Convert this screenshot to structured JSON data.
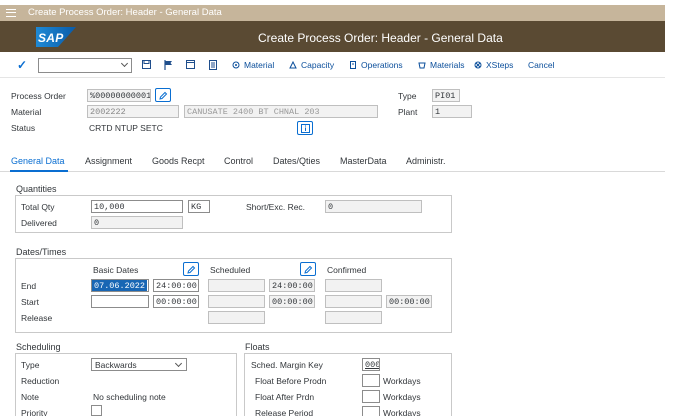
{
  "window": {
    "title": "Create Process Order: Header - General Data"
  },
  "shell": {
    "logo": "SAP",
    "title": "Create Process Order: Header - General Data"
  },
  "toolbar": {
    "confirm_icon": "check-icon",
    "command_value": "",
    "buttons": [
      {
        "label": "Material",
        "icon": "material-icon"
      },
      {
        "label": "Capacity",
        "icon": "capacity-icon"
      },
      {
        "label": "Operations",
        "icon": "operations-icon"
      },
      {
        "label": "Materials",
        "icon": "materials-icon"
      },
      {
        "label": "XSteps",
        "icon": "xsteps-icon"
      },
      {
        "label": "Cancel",
        "icon": ""
      }
    ]
  },
  "header": {
    "process_order": {
      "label": "Process Order",
      "value": "%00000000001"
    },
    "material": {
      "label": "Material",
      "value": "2002222",
      "description": "CANUSATE 2400 BT CHNAL 203"
    },
    "status": {
      "label": "Status",
      "value": "CRTD NTUP SETC"
    },
    "type": {
      "label": "Type",
      "value": "PI01"
    },
    "plant": {
      "label": "Plant",
      "value": "1"
    }
  },
  "tabs": [
    "General Data",
    "Assignment",
    "Goods Recpt",
    "Control",
    "Dates/Qties",
    "MasterData",
    "Administr."
  ],
  "quantities": {
    "title": "Quantities",
    "total_qty_label": "Total Qty",
    "total_qty": "10,000",
    "unit": "KG",
    "short_exc_label": "Short/Exc. Rec.",
    "short_exc_value": "0",
    "delivered_label": "Delivered",
    "delivered_value": "0"
  },
  "dates_times": {
    "title": "Dates/Times",
    "basic_dates_label": "Basic Dates",
    "scheduled_label": "Scheduled",
    "confirmed_label": "Confirmed",
    "end_label": "End",
    "start_label": "Start",
    "release_label": "Release",
    "end_basic_date": "07.06.2022",
    "end_basic_time": "24:00:00",
    "end_sched_time": "24:00:00",
    "start_basic_time": "00:00:00",
    "start_sched_time": "00:00:00",
    "start_confirmed_time": "00:00:00"
  },
  "scheduling": {
    "title": "Scheduling",
    "type_label": "Type",
    "type_value": "Backwards",
    "reduction_label": "Reduction",
    "note_label": "Note",
    "note_value": "No scheduling note",
    "priority_label": "Priority"
  },
  "floats": {
    "title": "Floats",
    "margin_key_label": "Sched. Margin Key",
    "margin_key_value": "000",
    "before_label": "Float Before Prodn",
    "after_label": "Float After Prdn",
    "release_period_label": "Release Period",
    "unit_label": "Workdays"
  }
}
